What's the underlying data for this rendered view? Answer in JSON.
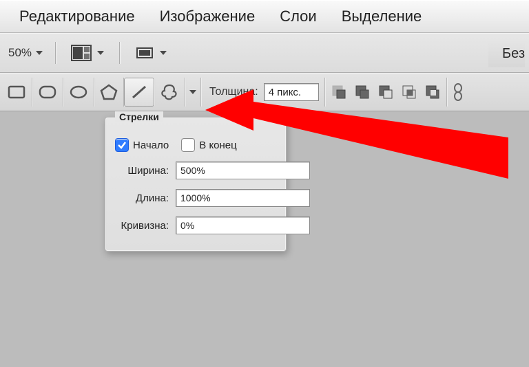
{
  "menu": {
    "edit": "Редактирование",
    "image": "Изображение",
    "layers": "Слои",
    "selection": "Выделение"
  },
  "options": {
    "zoom": "50%",
    "thickness_label": "Толщина:",
    "thickness_value": "4 пикс.",
    "doc_title": "Без"
  },
  "panel": {
    "title": "Стрелки",
    "start_label": "Начало",
    "end_label": "В конец",
    "start_checked": true,
    "end_checked": false,
    "width_label": "Ширина:",
    "width_value": "500%",
    "length_label": "Длина:",
    "length_value": "1000%",
    "curve_label": "Кривизна:",
    "curve_value": "0%"
  }
}
